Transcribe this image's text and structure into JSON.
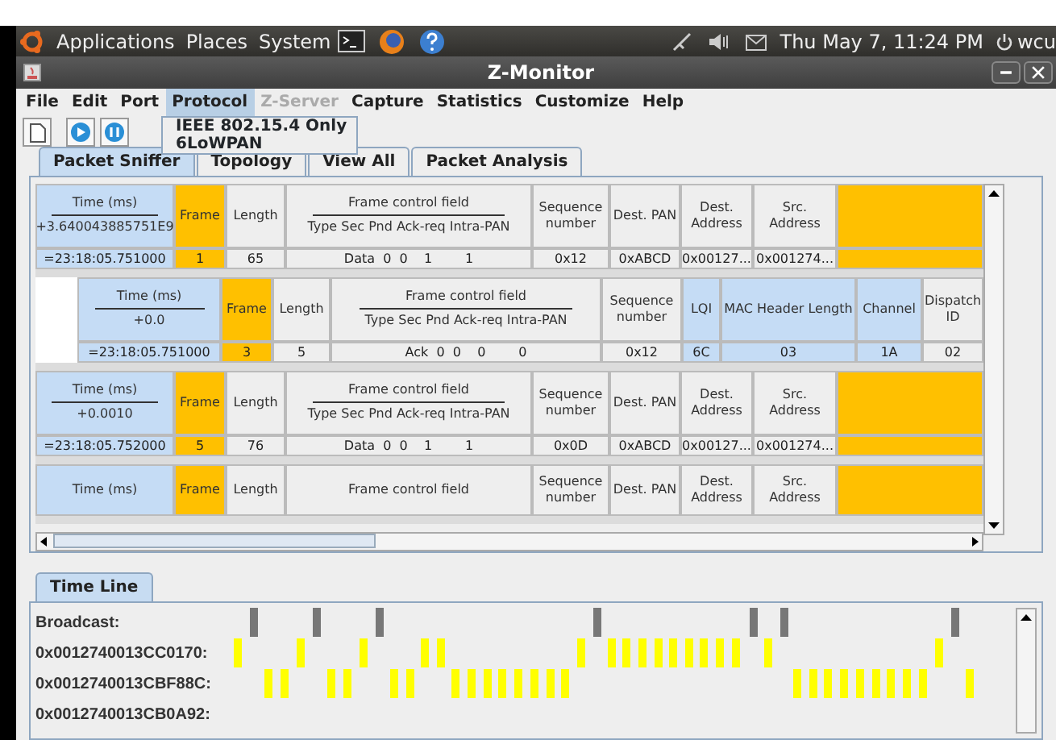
{
  "top_panel": {
    "menus": [
      "Applications",
      "Places",
      "System"
    ],
    "clock": "Thu May  7, 11:24 PM",
    "user": "wcu"
  },
  "window": {
    "title": "Z-Monitor"
  },
  "menubar": [
    {
      "label": "File",
      "selected": false,
      "disabled": false
    },
    {
      "label": "Edit",
      "selected": false,
      "disabled": false
    },
    {
      "label": "Port",
      "selected": false,
      "disabled": false
    },
    {
      "label": "Protocol",
      "selected": true,
      "disabled": false
    },
    {
      "label": "Z-Server",
      "selected": false,
      "disabled": true
    },
    {
      "label": "Capture",
      "selected": false,
      "disabled": false
    },
    {
      "label": "Statistics",
      "selected": false,
      "disabled": false
    },
    {
      "label": "Customize",
      "selected": false,
      "disabled": false
    },
    {
      "label": "Help",
      "selected": false,
      "disabled": false
    }
  ],
  "protocol_menu": [
    "IEEE 802.15.4 Only",
    "6LoWPAN"
  ],
  "tabs": [
    {
      "label": "Packet Sniffer",
      "selected": true
    },
    {
      "label": "Topology",
      "selected": false
    },
    {
      "label": "View All",
      "selected": false
    },
    {
      "label": "Packet Analysis",
      "selected": false
    }
  ],
  "packets": [
    {
      "kind": "mac",
      "columns": [
        {
          "header": "Time (ms)",
          "sub": "+3.640043885751E9",
          "value": "=23:18:05.751000",
          "color": "#c5dcf5"
        },
        {
          "header": "Frame",
          "value": "1",
          "color": "#ffc000"
        },
        {
          "header": "Length",
          "value": "65",
          "color": "#eeeeee"
        },
        {
          "header": "Frame control field",
          "sub": "Type Sec Pnd Ack-req Intra-PAN",
          "value": "Data  0  0    1        1",
          "color": "#eeeeee"
        },
        {
          "header": "Sequence number",
          "value": "0x12",
          "color": "#eeeeee"
        },
        {
          "header": "Dest. PAN",
          "value": "0xABCD",
          "color": "#eeeeee"
        },
        {
          "header": "Dest. Address",
          "value": "0x00127...",
          "color": "#eeeeee"
        },
        {
          "header": "Src. Address",
          "value": "0x001274...",
          "color": "#eeeeee"
        },
        {
          "color": "#ffc000"
        }
      ]
    },
    {
      "kind": "lowpan",
      "columns": [
        {
          "header": "Time (ms)",
          "sub": "+0.0",
          "value": "=23:18:05.751000",
          "color": "#c5dcf5"
        },
        {
          "header": "Frame",
          "value": "3",
          "color": "#ffc000"
        },
        {
          "header": "Length",
          "value": "5",
          "color": "#eeeeee"
        },
        {
          "header": "Frame control field",
          "sub": "Type Sec Pnd Ack-req Intra-PAN",
          "value": "Ack  0  0    0        0",
          "color": "#eeeeee"
        },
        {
          "header": "Sequence number",
          "value": "0x12",
          "color": "#eeeeee"
        },
        {
          "header": "LQI",
          "value": "6C",
          "color": "#c5dcf5"
        },
        {
          "header": "MAC Header Length",
          "value": "03",
          "color": "#c5dcf5"
        },
        {
          "header": "Channel",
          "value": "1A",
          "color": "#c5dcf5"
        },
        {
          "header": "Dispatch ID",
          "value": "02",
          "color": "#eeeeee"
        }
      ]
    },
    {
      "kind": "mac",
      "columns": [
        {
          "header": "Time (ms)",
          "sub": "+0.0010",
          "value": "=23:18:05.752000",
          "color": "#c5dcf5"
        },
        {
          "header": "Frame",
          "value": "5",
          "color": "#ffc000"
        },
        {
          "header": "Length",
          "value": "76",
          "color": "#eeeeee"
        },
        {
          "header": "Frame control field",
          "sub": "Type Sec Pnd Ack-req Intra-PAN",
          "value": "Data  0  0    1        1",
          "color": "#eeeeee"
        },
        {
          "header": "Sequence number",
          "value": "0x0D",
          "color": "#eeeeee"
        },
        {
          "header": "Dest. PAN",
          "value": "0xABCD",
          "color": "#eeeeee"
        },
        {
          "header": "Dest. Address",
          "value": "0x00127...",
          "color": "#eeeeee"
        },
        {
          "header": "Src. Address",
          "value": "0x001274...",
          "color": "#eeeeee"
        },
        {
          "color": "#ffc000"
        }
      ]
    },
    {
      "kind": "mac",
      "columns": [
        {
          "header": "Time (ms)",
          "color": "#c5dcf5"
        },
        {
          "header": "Frame",
          "color": "#ffc000"
        },
        {
          "header": "Length",
          "color": "#eeeeee"
        },
        {
          "header": "Frame control field",
          "color": "#eeeeee"
        },
        {
          "header": "Sequence number",
          "color": "#eeeeee"
        },
        {
          "header": "Dest. PAN",
          "color": "#eeeeee"
        },
        {
          "header": "Dest. Address",
          "color": "#eeeeee"
        },
        {
          "header": "Src. Address",
          "color": "#eeeeee"
        },
        {
          "color": "#ffc000"
        }
      ]
    }
  ],
  "timeline": {
    "tab": "Time Line",
    "rows": [
      {
        "label": "Broadcast:",
        "color": "#777777"
      },
      {
        "label": "0x0012740013CC0170:",
        "color": "#ffff00"
      },
      {
        "label": "0x0012740013CBF88C:",
        "color": "#ffff00"
      },
      {
        "label": "0x0012740013CB0A92:"
      }
    ]
  }
}
